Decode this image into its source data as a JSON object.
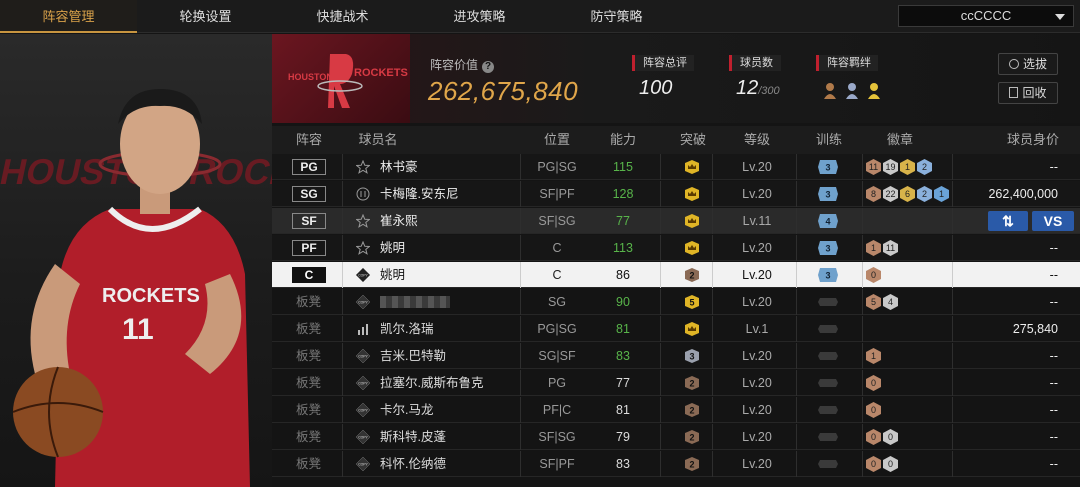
{
  "tabs": [
    {
      "label": "阵容管理",
      "active": true
    },
    {
      "label": "轮换设置",
      "active": false
    },
    {
      "label": "快捷战术",
      "active": false
    },
    {
      "label": "进攻策略",
      "active": false
    },
    {
      "label": "防守策略",
      "active": false
    }
  ],
  "team_select": {
    "value": "ccCCCC"
  },
  "header": {
    "team_logo_text": "ROCKETS",
    "team_logo_city": "HOUSTON",
    "value_label": "阵容价值",
    "value_help": "?",
    "value": "262,675,840",
    "rating_label": "阵容总评",
    "rating": "100",
    "count_label": "球员数",
    "count": "12",
    "count_max": "/300",
    "bond_label": "阵容羁绊",
    "buttons": {
      "filter": "选拔",
      "back": "回收"
    }
  },
  "player_panel": {
    "jersey_team": "ROCKETS",
    "jersey_number": "11",
    "bg_text": "HOUSTON ROCKETS"
  },
  "table": {
    "headers": [
      "阵容",
      "球员名",
      "位置",
      "能力",
      "突破",
      "等级",
      "训练",
      "徽章",
      "球员身价"
    ],
    "rows": [
      {
        "slot": "PG",
        "bench": false,
        "icon": "star",
        "name": "林书豪",
        "pos": "PG|SG",
        "ability": "115",
        "green": true,
        "break": "crown",
        "level": "Lv.20",
        "train": "3",
        "badges": [
          "11",
          "19",
          "1",
          "2"
        ],
        "value": "--"
      },
      {
        "slot": "SG",
        "bench": false,
        "icon": "ring",
        "name": "卡梅隆.安东尼",
        "pos": "SF|PF",
        "ability": "128",
        "green": true,
        "break": "crown",
        "level": "Lv.20",
        "train": "3",
        "badges": [
          "8",
          "22",
          "6",
          "2",
          "1"
        ],
        "value": "262,400,000"
      },
      {
        "slot": "SF",
        "bench": false,
        "icon": "star",
        "name": "崔永熙",
        "pos": "SF|SG",
        "ability": "77",
        "green": true,
        "break": "crown",
        "level": "Lv.11",
        "train": "4",
        "badges": [],
        "value": "",
        "actions": true
      },
      {
        "slot": "PF",
        "bench": false,
        "icon": "star",
        "name": "姚明",
        "pos": "C",
        "ability": "113",
        "green": true,
        "break": "crown",
        "level": "Lv.20",
        "train": "3",
        "badges": [
          "1",
          "11"
        ],
        "value": "--"
      },
      {
        "slot": "C",
        "bench": false,
        "icon": "copy",
        "name": "姚明",
        "pos": "C",
        "ability": "86",
        "green": false,
        "break": "2",
        "level": "Lv.20",
        "train": "3",
        "badges": [
          "0"
        ],
        "value": "--"
      },
      {
        "slot": "板凳",
        "bench": true,
        "icon": "copy",
        "name": "",
        "pos": "SG",
        "ability": "90",
        "green": true,
        "break": "5",
        "level": "Lv.20",
        "train": "",
        "badges": [
          "5",
          "4"
        ],
        "value": "--"
      },
      {
        "slot": "板凳",
        "bench": true,
        "icon": "bars",
        "name": "凯尔.洛瑞",
        "pos": "PG|SG",
        "ability": "81",
        "green": true,
        "break": "crown",
        "level": "Lv.1",
        "train": "",
        "badges": [],
        "value": "275,840"
      },
      {
        "slot": "板凳",
        "bench": true,
        "icon": "copy",
        "name": "吉米.巴特勒",
        "pos": "SG|SF",
        "ability": "83",
        "green": true,
        "break": "3",
        "level": "Lv.20",
        "train": "",
        "badges": [
          "1"
        ],
        "value": "--"
      },
      {
        "slot": "板凳",
        "bench": true,
        "icon": "copy",
        "name": "拉塞尔.威斯布鲁克",
        "pos": "PG",
        "ability": "77",
        "green": false,
        "break": "2",
        "level": "Lv.20",
        "train": "",
        "badges": [
          "0"
        ],
        "value": "--"
      },
      {
        "slot": "板凳",
        "bench": true,
        "icon": "copy",
        "name": "卡尔.马龙",
        "pos": "PF|C",
        "ability": "81",
        "green": false,
        "break": "2",
        "level": "Lv.20",
        "train": "",
        "badges": [
          "0"
        ],
        "value": "--"
      },
      {
        "slot": "板凳",
        "bench": true,
        "icon": "copy",
        "name": "斯科特.皮蓬",
        "pos": "SF|SG",
        "ability": "79",
        "green": false,
        "break": "2",
        "level": "Lv.20",
        "train": "",
        "badges": [
          "0",
          "0"
        ],
        "value": "--"
      },
      {
        "slot": "板凳",
        "bench": true,
        "icon": "copy",
        "name": "科怀.伦纳德",
        "pos": "SF|PF",
        "ability": "83",
        "green": false,
        "break": "2",
        "level": "Lv.20",
        "train": "",
        "badges": [
          "0",
          "0"
        ],
        "value": "--"
      }
    ],
    "actions": {
      "swap": "⇅",
      "vs": "VS"
    }
  },
  "colors": {
    "accent": "#d9a24a",
    "green": "#58b44a",
    "red": "#c0202e",
    "blue": "#2a5aa8"
  }
}
